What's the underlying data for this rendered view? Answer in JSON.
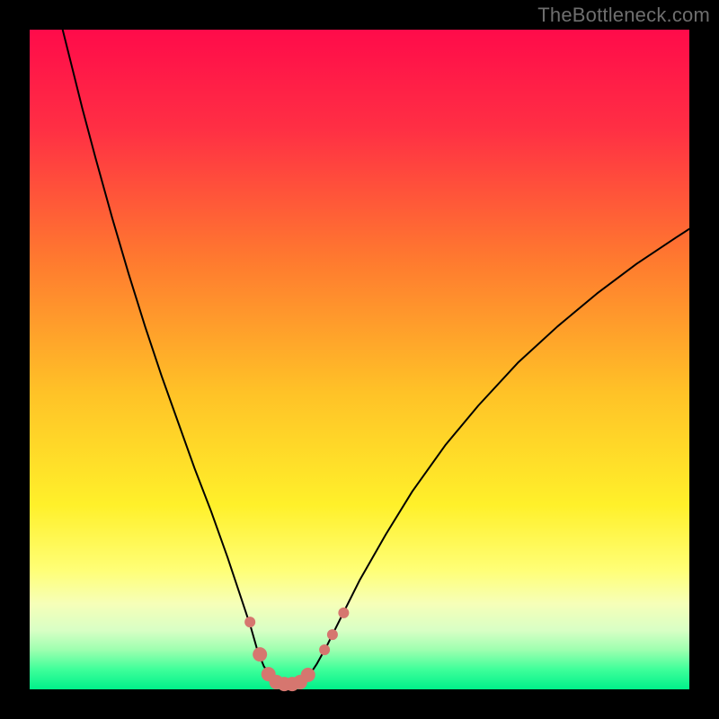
{
  "watermark": "TheBottleneck.com",
  "chart_data": {
    "type": "line",
    "title": "",
    "xlabel": "",
    "ylabel": "",
    "xlim": [
      0,
      100
    ],
    "ylim": [
      0,
      100
    ],
    "background_gradient": {
      "stops": [
        {
          "offset": 0.0,
          "color": "#ff0b4a"
        },
        {
          "offset": 0.15,
          "color": "#ff2f44"
        },
        {
          "offset": 0.35,
          "color": "#ff7a2f"
        },
        {
          "offset": 0.55,
          "color": "#ffc227"
        },
        {
          "offset": 0.72,
          "color": "#fff02a"
        },
        {
          "offset": 0.82,
          "color": "#ffff77"
        },
        {
          "offset": 0.87,
          "color": "#f6ffb8"
        },
        {
          "offset": 0.91,
          "color": "#d9ffc5"
        },
        {
          "offset": 0.94,
          "color": "#9effb0"
        },
        {
          "offset": 0.97,
          "color": "#3eff9a"
        },
        {
          "offset": 1.0,
          "color": "#00f08a"
        }
      ]
    },
    "series": [
      {
        "name": "bottleneck-curve",
        "color": "#000000",
        "width": 2,
        "points": [
          {
            "x": 5.0,
            "y": 100.0
          },
          {
            "x": 6.5,
            "y": 94.0
          },
          {
            "x": 8.0,
            "y": 88.0
          },
          {
            "x": 10.0,
            "y": 80.5
          },
          {
            "x": 12.5,
            "y": 71.5
          },
          {
            "x": 15.0,
            "y": 63.0
          },
          {
            "x": 17.5,
            "y": 55.0
          },
          {
            "x": 20.0,
            "y": 47.5
          },
          {
            "x": 22.5,
            "y": 40.5
          },
          {
            "x": 25.0,
            "y": 33.5
          },
          {
            "x": 27.5,
            "y": 27.0
          },
          {
            "x": 30.0,
            "y": 20.0
          },
          {
            "x": 32.0,
            "y": 14.0
          },
          {
            "x": 33.5,
            "y": 9.5
          },
          {
            "x": 34.5,
            "y": 6.0
          },
          {
            "x": 35.5,
            "y": 3.5
          },
          {
            "x": 36.5,
            "y": 2.0
          },
          {
            "x": 37.5,
            "y": 1.2
          },
          {
            "x": 38.5,
            "y": 0.8
          },
          {
            "x": 39.5,
            "y": 0.7
          },
          {
            "x": 40.5,
            "y": 0.8
          },
          {
            "x": 41.5,
            "y": 1.3
          },
          {
            "x": 42.5,
            "y": 2.3
          },
          {
            "x": 43.5,
            "y": 3.8
          },
          {
            "x": 45.0,
            "y": 6.5
          },
          {
            "x": 47.0,
            "y": 10.5
          },
          {
            "x": 50.0,
            "y": 16.5
          },
          {
            "x": 54.0,
            "y": 23.5
          },
          {
            "x": 58.0,
            "y": 30.0
          },
          {
            "x": 63.0,
            "y": 37.0
          },
          {
            "x": 68.0,
            "y": 43.0
          },
          {
            "x": 74.0,
            "y": 49.5
          },
          {
            "x": 80.0,
            "y": 55.0
          },
          {
            "x": 86.0,
            "y": 60.0
          },
          {
            "x": 92.0,
            "y": 64.5
          },
          {
            "x": 98.0,
            "y": 68.5
          },
          {
            "x": 100.0,
            "y": 69.8
          }
        ]
      }
    ],
    "markers": {
      "name": "fit-markers",
      "color": "#d6766f",
      "radius_big": 8,
      "radius_small": 6,
      "points": [
        {
          "x": 33.4,
          "y": 10.2,
          "r": "small"
        },
        {
          "x": 34.9,
          "y": 5.3,
          "r": "big"
        },
        {
          "x": 36.2,
          "y": 2.3,
          "r": "big"
        },
        {
          "x": 37.4,
          "y": 1.1,
          "r": "big"
        },
        {
          "x": 38.6,
          "y": 0.8,
          "r": "big"
        },
        {
          "x": 39.8,
          "y": 0.8,
          "r": "big"
        },
        {
          "x": 41.0,
          "y": 1.1,
          "r": "big"
        },
        {
          "x": 42.2,
          "y": 2.2,
          "r": "big"
        },
        {
          "x": 44.7,
          "y": 6.0,
          "r": "small"
        },
        {
          "x": 45.9,
          "y": 8.3,
          "r": "small"
        },
        {
          "x": 47.6,
          "y": 11.6,
          "r": "small"
        }
      ]
    }
  }
}
